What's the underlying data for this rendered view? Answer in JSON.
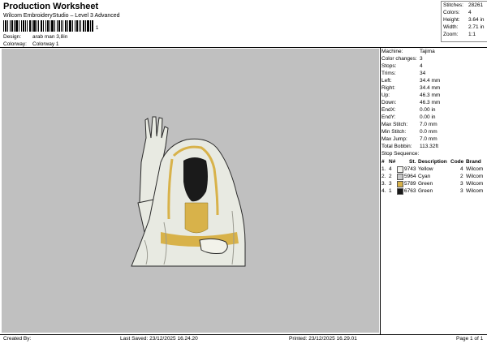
{
  "header": {
    "title": "Production Worksheet",
    "subtitle": "Wilcom EmbroideryStudio – Level 3 Advanced",
    "barcode_number": "1",
    "design_label": "Design:",
    "design_value": "arab man 3,8in",
    "colorway_label": "Colorway:",
    "colorway_value": "Colorway 1"
  },
  "stats": [
    {
      "label": "Stitches:",
      "value": "28261"
    },
    {
      "label": "Colors:",
      "value": "4"
    },
    {
      "label": "Height:",
      "value": "3.64 in"
    },
    {
      "label": "Width:",
      "value": "2.71 in"
    },
    {
      "label": "Zoom:",
      "value": "1:1"
    }
  ],
  "machine_info": [
    {
      "label": "Machine:",
      "value": "Tajima"
    },
    {
      "label": "Color changes:",
      "value": "3"
    },
    {
      "label": "Stops:",
      "value": "4"
    },
    {
      "label": "Trims:",
      "value": "34"
    },
    {
      "label": "Left:",
      "value": "34.4 mm"
    },
    {
      "label": "Right:",
      "value": "34.4 mm"
    },
    {
      "label": "Up:",
      "value": "46.3 mm"
    },
    {
      "label": "Down:",
      "value": "46.3 mm"
    },
    {
      "label": "EndX:",
      "value": "0.00 in"
    },
    {
      "label": "EndY:",
      "value": "0.00 in"
    },
    {
      "label": "Max Stitch:",
      "value": "7.0 mm"
    },
    {
      "label": "Min Stitch:",
      "value": "0.0 mm"
    },
    {
      "label": "Max Jump:",
      "value": "7.0 mm"
    },
    {
      "label": "Total Bobbin:",
      "value": "113.32ft"
    }
  ],
  "stop_sequence": {
    "heading": "Stop Sequence:",
    "columns": [
      "#",
      "N#",
      "St.",
      "Description",
      "Code",
      "Brand"
    ],
    "rows": [
      {
        "num": "1.",
        "n": "4",
        "st": "9743",
        "color": "#f4f4f0",
        "description": "Yellow",
        "code": "4",
        "brand": "Wilcom"
      },
      {
        "num": "2.",
        "n": "2",
        "st": "5964",
        "color": "#c8c8c8",
        "description": "Cyan",
        "code": "2",
        "brand": "Wilcom"
      },
      {
        "num": "3.",
        "n": "3",
        "st": "5789",
        "color": "#d8b24a",
        "description": "Green",
        "code": "3",
        "brand": "Wilcom"
      },
      {
        "num": "4.",
        "n": "1",
        "st": "6763",
        "color": "#1a1a1a",
        "description": "Green",
        "code": "3",
        "brand": "Wilcom"
      }
    ]
  },
  "footer": {
    "created_by": "Created By:",
    "last_saved": "Last Saved: 23/12/2025 16.24.20",
    "printed": "Printed: 23/12/2025 16.29.01",
    "page": "Page 1 of 1"
  },
  "colors": {
    "canvas_bg": "#c0c0c0",
    "robe_white": "#e8eae2",
    "gold": "#d8b24a",
    "dark": "#1a1a1a"
  }
}
